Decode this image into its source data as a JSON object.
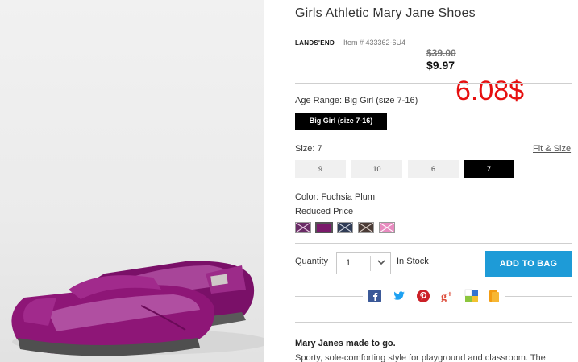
{
  "product": {
    "title": "Girls Athletic Mary Jane Shoes",
    "brand": "LANDS'END",
    "item_number": "Item # 433362-6U4",
    "price_original": "$39.00",
    "price_sale": "$9.97"
  },
  "annotation": "6.08$",
  "age_range": {
    "label": "Age Range: Big Girl (size 7-16)",
    "button": "Big Girl (size 7-16)"
  },
  "size": {
    "label": "Size: 7",
    "fit_link": "Fit & Size",
    "options": [
      "9",
      "10",
      "6",
      "7"
    ],
    "selected": "7"
  },
  "color": {
    "label": "Color: Fuchsia Plum",
    "sublabel": "Reduced Price",
    "swatches": [
      {
        "name": "swatch-1",
        "color": "#6a2c66",
        "style": "cross"
      },
      {
        "name": "swatch-2",
        "color": "#7a1a6b",
        "style": "solid"
      },
      {
        "name": "swatch-3",
        "color": "#2f3b55",
        "style": "cross"
      },
      {
        "name": "swatch-4",
        "color": "#4a3b36",
        "style": "cross"
      },
      {
        "name": "swatch-5",
        "color": "#e88bc0",
        "style": "cross"
      }
    ]
  },
  "quantity": {
    "label": "Quantity",
    "value": "1",
    "stock": "In Stock"
  },
  "cart": {
    "add_label": "ADD TO BAG"
  },
  "social": [
    {
      "icon": "facebook-icon",
      "color": "#3b5998"
    },
    {
      "icon": "twitter-icon",
      "color": "#1da1f2"
    },
    {
      "icon": "pinterest-icon",
      "color": "#cb2027"
    },
    {
      "icon": "googleplus-icon",
      "color": "#dd4b39"
    },
    {
      "icon": "delicious-icon",
      "color": "#3274d1"
    },
    {
      "icon": "bookmark-icon",
      "color": "#f39c12"
    }
  ],
  "description": {
    "title": "Mary Janes made to go.",
    "text": "Sporty, sole-comforting style for playground and classroom. The"
  },
  "colors": {
    "accent": "#1e9bd7",
    "annotation": "#e61010",
    "shoe": "#8e1677"
  }
}
